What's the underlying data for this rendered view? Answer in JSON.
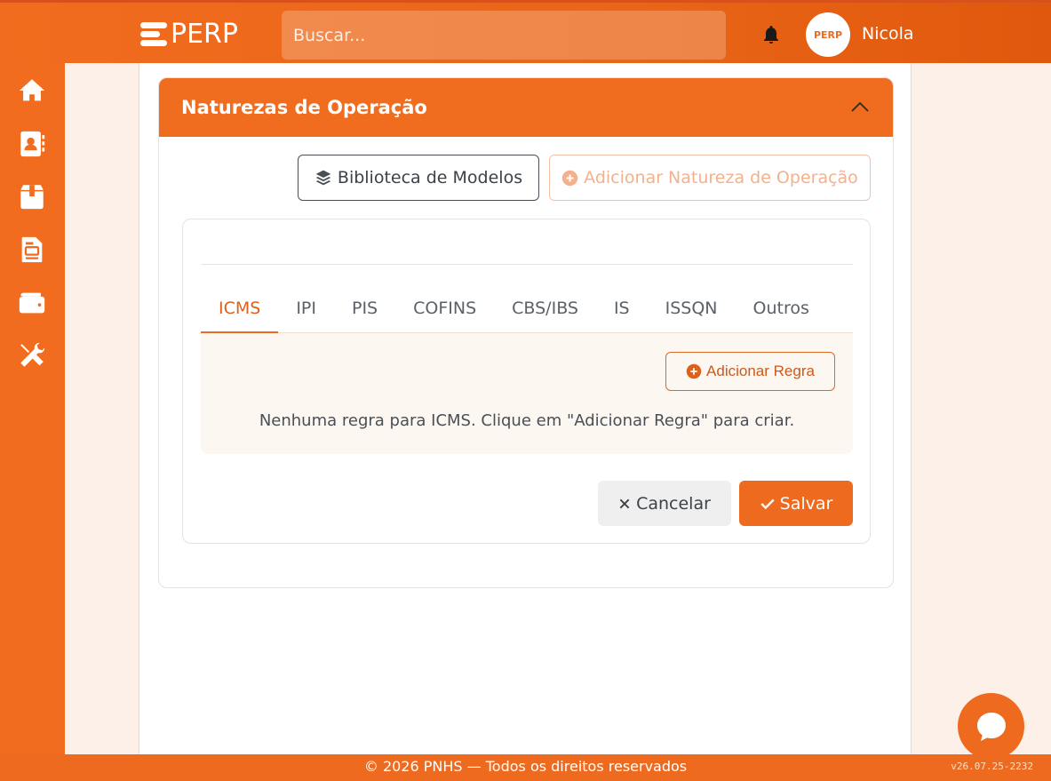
{
  "app": {
    "logo_text": "PERP",
    "search_placeholder": "Buscar...",
    "user_name": "Nicola",
    "avatar_text": "PERP"
  },
  "sidebar": {
    "items": [
      {
        "icon": "home-icon"
      },
      {
        "icon": "contacts-icon"
      },
      {
        "icon": "box-icon"
      },
      {
        "icon": "document-icon"
      },
      {
        "icon": "wallet-icon"
      },
      {
        "icon": "tools-icon"
      }
    ]
  },
  "card": {
    "title": "Naturezas de Operação",
    "library_button": "Biblioteca de Modelos",
    "add_nature_button": "Adicionar Natureza de Operação"
  },
  "tabs": [
    "ICMS",
    "IPI",
    "PIS",
    "COFINS",
    "CBS/IBS",
    "IS",
    "ISSQN",
    "Outros"
  ],
  "active_tab": "ICMS",
  "rules": {
    "add_rule_button": "Adicionar Regra",
    "empty_message": "Nenhuma regra para ICMS. Clique em \"Adicionar Regra\" para criar."
  },
  "actions": {
    "cancel": "Cancelar",
    "save": "Salvar"
  },
  "footer": {
    "text": "© 2026 PNHS — Todos os direitos reservados",
    "version": "v26.07.25-2232"
  },
  "colors": {
    "brand": "#ee6a1f",
    "accent_light": "#fdf0e8"
  }
}
